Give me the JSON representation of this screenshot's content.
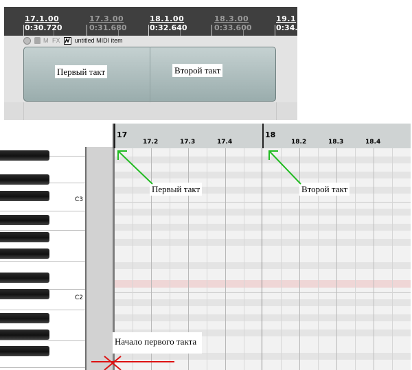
{
  "arrange": {
    "ruler": [
      {
        "bar": "17.1.00",
        "time": "0:30.720",
        "dim": false
      },
      {
        "bar": "17.3.00",
        "time": "0:31.680",
        "dim": true
      },
      {
        "bar": "18.1.00",
        "time": "0:32.640",
        "dim": false
      },
      {
        "bar": "18.3.00",
        "time": "0:33.600",
        "dim": true
      },
      {
        "bar": "19.1",
        "time": "0:34.",
        "dim": false
      }
    ],
    "track_buttons": {
      "mute": "M",
      "fx": "FX"
    },
    "item_name": "untitled MIDI item",
    "annotations": {
      "first_measure": "Первый такт",
      "second_measure": "Второй такт"
    }
  },
  "piano_roll": {
    "bars": [
      {
        "number": "17",
        "beats": [
          "17.2",
          "17.3",
          "17.4"
        ]
      },
      {
        "number": "18",
        "beats": [
          "18.2",
          "18.3",
          "18.4"
        ]
      }
    ],
    "key_labels": {
      "c3": "C3",
      "c2": "C2"
    },
    "annotations": {
      "first_measure": "Первый такт",
      "second_measure": "Второй такт",
      "start_of_first": "Начало первого такта"
    }
  },
  "colors": {
    "arrow_green": "#22bb22",
    "marker_red": "#dd1111"
  }
}
